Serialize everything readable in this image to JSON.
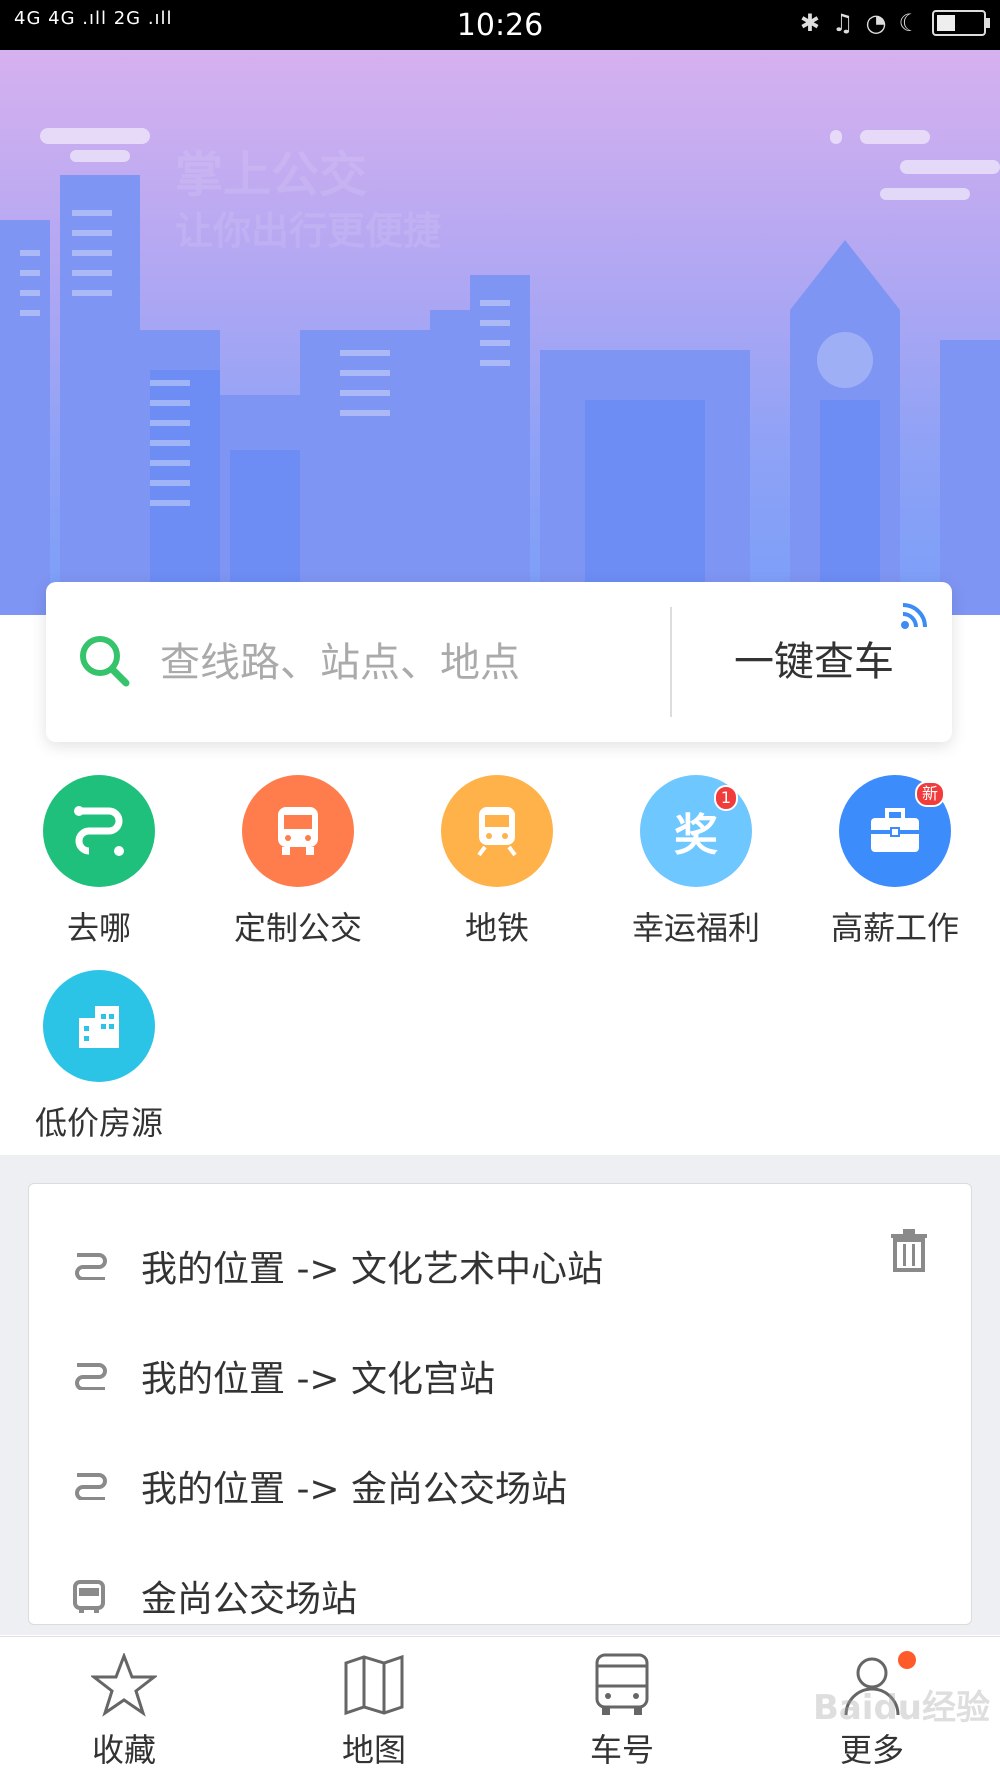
{
  "statusbar": {
    "network": "4G 4G .ıll 2G .ıll",
    "time": "10:26",
    "icons": [
      "bluetooth-icon",
      "mute-bell-icon",
      "alarm-icon",
      "moon-icon",
      "battery-icon"
    ],
    "battery_level": 0.45
  },
  "banner": {
    "slogan_line1": "掌上公交",
    "slogan_line2": "让你出行更便捷"
  },
  "search": {
    "placeholder": "查线路、站点、地点",
    "quick_check_label": "一键查车"
  },
  "shortcuts": [
    {
      "label": "去哪",
      "icon": "route-icon",
      "color": "#1fc07b"
    },
    {
      "label": "定制公交",
      "icon": "bus-icon",
      "color": "#ff7d4d"
    },
    {
      "label": "地铁",
      "icon": "subway-icon",
      "color": "#ffb24a"
    },
    {
      "label": "幸运福利",
      "icon": "prize-icon",
      "color": "#6ec7ff",
      "badge": "1"
    },
    {
      "label": "高薪工作",
      "icon": "briefcase-icon",
      "color": "#3c8dfb",
      "badge": "新"
    },
    {
      "label": "低价房源",
      "icon": "building-icon",
      "color": "#2bc4e6"
    }
  ],
  "history": [
    {
      "text": "我的位置 -> 文化艺术中心站",
      "icon": "route-icon"
    },
    {
      "text": "我的位置 -> 文化宫站",
      "icon": "route-icon"
    },
    {
      "text": "我的位置 -> 金尚公交场站",
      "icon": "route-icon"
    },
    {
      "text": "金尚公交场站",
      "icon": "bus-icon"
    }
  ],
  "tabs": [
    {
      "label": "收藏",
      "icon": "star-icon"
    },
    {
      "label": "地图",
      "icon": "map-icon"
    },
    {
      "label": "车号",
      "icon": "bus-icon"
    },
    {
      "label": "更多",
      "icon": "person-icon"
    }
  ],
  "watermark": "Baidu经验",
  "colors": {
    "search_green": "#35c46b",
    "icon_gray": "#8a8a8a",
    "badge_red": "#f23b3b"
  }
}
